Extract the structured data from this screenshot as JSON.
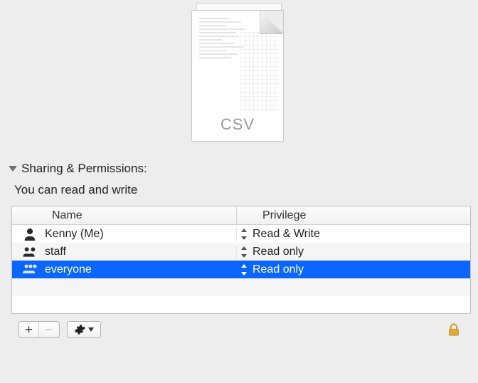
{
  "file": {
    "type_label": "CSV"
  },
  "section": {
    "title": "Sharing & Permissions:",
    "summary": "You can read and write"
  },
  "table": {
    "columns": {
      "name": "Name",
      "privilege": "Privilege"
    },
    "rows": [
      {
        "icon": "user-icon",
        "name": "Kenny (Me)",
        "privilege": "Read & Write",
        "selected": false
      },
      {
        "icon": "group-icon",
        "name": "staff",
        "privilege": "Read only",
        "selected": false
      },
      {
        "icon": "world-icon",
        "name": "everyone",
        "privilege": "Read only",
        "selected": true
      }
    ]
  },
  "toolbar": {
    "add_label": "+",
    "remove_label": "−",
    "remove_enabled": false,
    "locked": true
  }
}
